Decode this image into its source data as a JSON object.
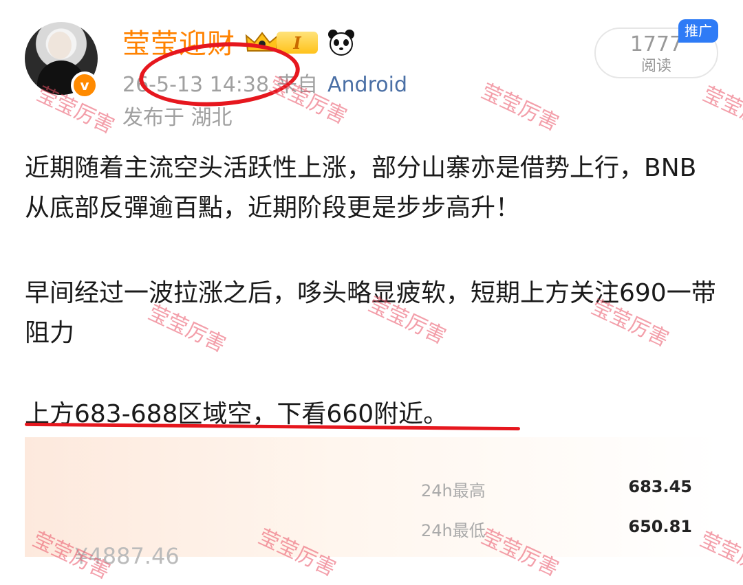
{
  "header": {
    "username": "莹莹迎财",
    "level_badge": "I",
    "timestamp": "26-5-13 14:38",
    "source_prefix": "来自",
    "device": "Android",
    "location": "发布于 湖北"
  },
  "reads": {
    "count": "1777",
    "label": "阅读",
    "ad_badge": "推广"
  },
  "post": {
    "paragraphs": [
      "近期随着主流空头活跃性上涨，部分山寨亦是借势上行，BNB从底部反彈逾百點，近期阶段更是步步高升！",
      "早间经过一波拉涨之后，哆头略显疲软，短期上方关注690一带阻力",
      "上方683-688区域空，下看660附近。"
    ]
  },
  "price_card": {
    "rows": [
      {
        "label": "24h最高",
        "value": "683.45"
      },
      {
        "label": "24h最低",
        "value": "650.81"
      }
    ],
    "price_partial": "¥4887.46"
  },
  "watermark": "莹莹厉害",
  "colors": {
    "username": "#ff8200",
    "annotation_red": "#e6171e",
    "ad_blue": "#2e7bf6",
    "device_link": "#4a6fa5"
  },
  "icons": [
    "crown-icon",
    "panda-emoji-icon",
    "verified-badge-icon"
  ]
}
